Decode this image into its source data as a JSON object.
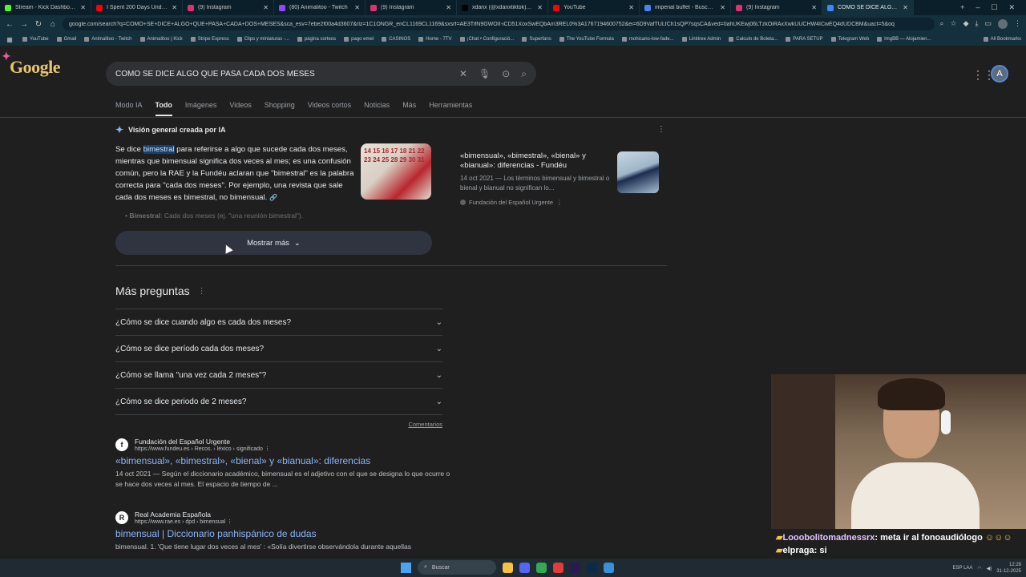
{
  "browser": {
    "tabs": [
      {
        "label": "Stream - Kick Dashboard",
        "color": "#53fc18"
      },
      {
        "label": "I Spent 200 Days Undercover",
        "color": "#ff0000"
      },
      {
        "label": "(9) Instagram",
        "color": "#e1306c"
      },
      {
        "label": "(80) Animalitoo - Twitch",
        "color": "#9146ff"
      },
      {
        "label": "(9) Instagram",
        "color": "#e1306c"
      },
      {
        "label": "xdanx (@xdanxtiktok) | TikTok",
        "color": "#000000"
      },
      {
        "label": "YouTube",
        "color": "#ff0000"
      },
      {
        "label": "imperial buffet - Buscar con G",
        "color": "#4285f4"
      },
      {
        "label": "(9) Instagram",
        "color": "#e1306c"
      },
      {
        "label": "COMO SE DICE ALGO QUE PA",
        "color": "#4285f4"
      }
    ],
    "url": "google.com/search?q=COMO+SE+DICE+ALGO+QUE+PASA+CADA+DOS+MESES&sca_esv=7ebe2f00a4d3607&rlz=1C1ONGR_enCL1169CL1169&sxsrf=AE3TifN9GWOII-iCD51XoxSwEQbAm3REL0%3A1767194600752&ei=6D9VafTULfCh1sQP7sqsCA&ved=0ahUKEwj06LTzkOiRAxXwkUUCHW4ICwEQ4dUDCBM&uact=5&oq",
    "bookmarks": [
      "YouTube",
      "Gmail",
      "Animalitoo - Twitch",
      "Animalitoo | Kick",
      "Stripe Express",
      "Clips y miniaturas -...",
      "página sorteos",
      "pago emel",
      "CASINOS",
      "Home - 7TV",
      "¡Chat • Configuració...",
      "Superfans",
      "The YouTube Formula",
      "mohicano-low-fade...",
      "Linktree Admin",
      "Calculo de Boleta...",
      "PARA SETUP",
      "Telegram Web",
      "ImgBB — Alojamien..."
    ],
    "all_bookmarks": "All Bookmarks"
  },
  "search": {
    "query": "COMO SE DICE ALGO QUE PASA CADA DOS MESES",
    "logo_text": "Google",
    "profile_initial": "A",
    "tabs": [
      "Modo IA",
      "Todo",
      "Imágenes",
      "Videos",
      "Shopping",
      "Videos cortos",
      "Noticias",
      "Más",
      "Herramientas"
    ],
    "active_tab": "Todo"
  },
  "ai_overview": {
    "title": "Visión general creada por IA",
    "text_pre": "Se dice ",
    "highlight": "bimestral",
    "text_post": " para referirse a algo que sucede cada dos meses, mientras que bimensual significa dos veces al mes; es una confusión común, pero la RAE y la Fundéu aclaran que \"bimestral\" es la palabra correcta para \"cada dos meses\". Por ejemplo, una revista que sale cada dos meses es bimestral, no bimensual.",
    "image_text": "14 15 16 17 18 21 22 23 24 25 28 29 30 31",
    "bullet_bold": "Bimestral",
    "bullet_text": ": Cada dos meses (ej. \"una reunión bimestral\").",
    "source": {
      "title": "«bimensual», «bimestral», «bienal» y «bianual»: diferencias - Fundéu",
      "desc": "14 oct 2021 — Los términos bimensual y bimestral o bienal y bianual no significan lo...",
      "name": "Fundación del Español Urgente"
    },
    "show_more": "Mostrar más"
  },
  "paa": {
    "title": "Más preguntas",
    "questions": [
      "¿Cómo se dice cuando algo es cada dos meses?",
      "¿Cómo se dice período cada dos meses?",
      "¿Cómo se llama \"una vez cada 2 meses\"?",
      "¿Cómo se dice periodo de 2 meses?"
    ],
    "comments": "Comentarios"
  },
  "results": [
    {
      "favicon": "f",
      "site": "Fundación del Español Urgente",
      "url": "https://www.fundeu.es › Recos. › léxico › significado",
      "title": "«bimensual», «bimestral», «bienal» y «bianual»: diferencias",
      "snippet": "14 oct 2021 — Según el diccionario académico, bimensual es el adjetivo con el que se designa lo que ocurre o se hace dos veces al mes. El espacio de tiempo de ..."
    },
    {
      "favicon": "R",
      "site": "Real Academia Española",
      "url": "https://www.rae.es › dpd › bimensual",
      "title": "bimensual | Diccionario panhispánico de dudas",
      "snippet": "bimensual. 1. 'Que tiene lugar dos veces al mes' : «Solía divertirse observándola durante aquellas"
    }
  ],
  "chat": {
    "user1": "Looobolitomadnessrx",
    "msg1": ": meta ir al fonoaudiólogo",
    "user2": "elpraga",
    "msg2": ": si"
  },
  "taskbar": {
    "search_label": "Buscar",
    "lang": "ESP LAA",
    "time": "12:28",
    "date": "31-12-2025"
  }
}
